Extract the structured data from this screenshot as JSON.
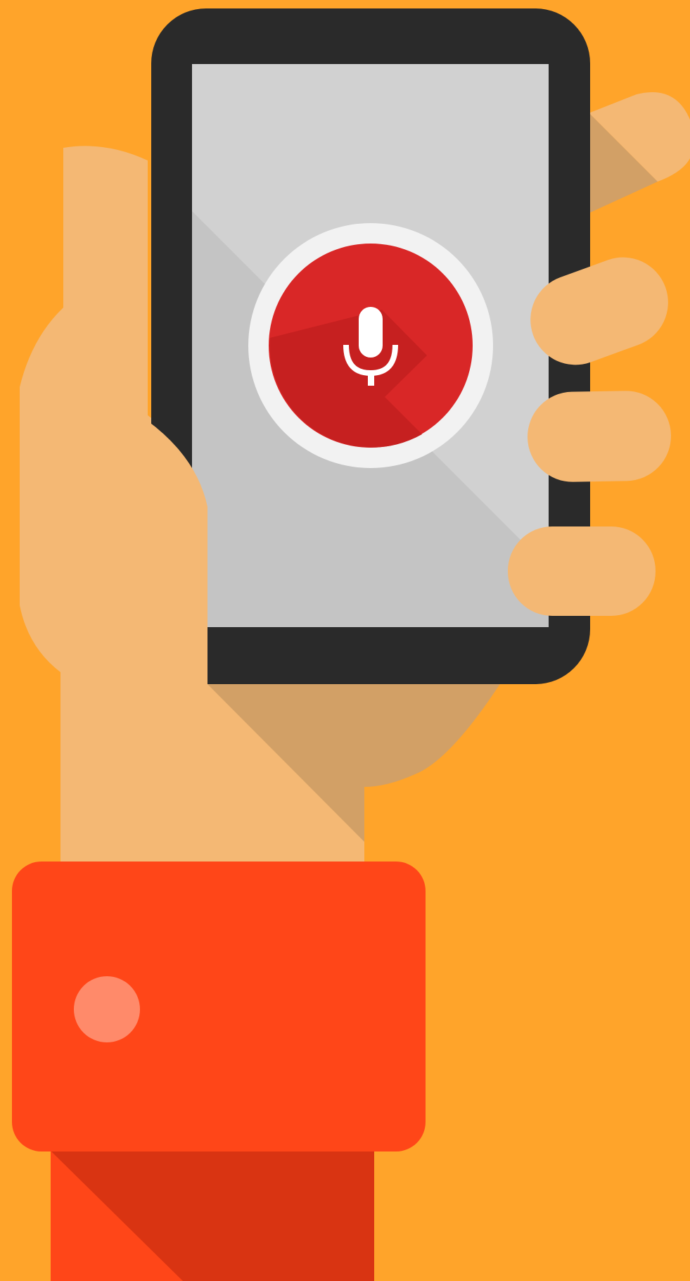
{
  "illustration": {
    "subject": "hand-holding-phone-with-voice-search",
    "icon": "microphone-icon",
    "colors": {
      "background": "#FFA42A",
      "skin": "#F4B874",
      "skin_shadow": "#D2A066",
      "phone_body": "#2A2A2A",
      "screen_light": "#D1D1D1",
      "screen_dark": "#C4C4C4",
      "mic_ring": "#F2F2F2",
      "mic_button": "#D92727",
      "mic_button_shadow": "#C62020",
      "mic_glyph": "#FFFFFF",
      "sleeve": "#FF4618",
      "sleeve_shadow": "#D93412",
      "sleeve_button": "#FF8A6A"
    }
  }
}
